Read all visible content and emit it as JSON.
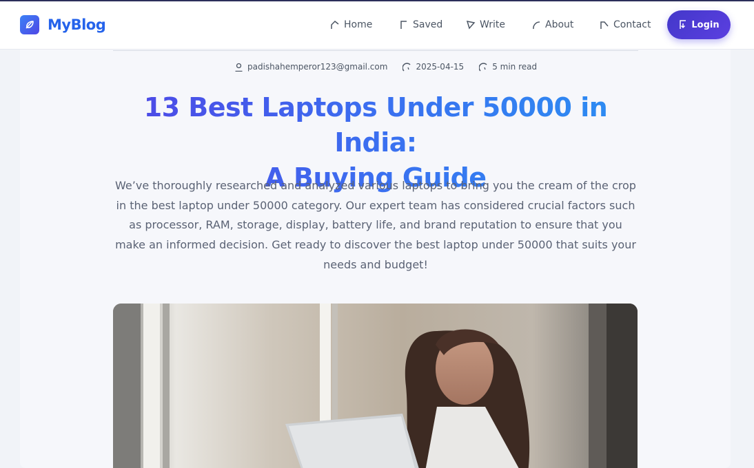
{
  "brand": {
    "name": "MyBlog",
    "logo_icon": "feather-icon"
  },
  "nav": [
    {
      "label": "Home",
      "icon": "home-icon"
    },
    {
      "label": "Saved",
      "icon": "bookmark-icon"
    },
    {
      "label": "Write",
      "icon": "pen-icon"
    },
    {
      "label": "About",
      "icon": "info-icon"
    },
    {
      "label": "Contact",
      "icon": "mail-icon"
    }
  ],
  "login": {
    "label": "Login",
    "icon": "login-icon"
  },
  "meta": {
    "author": "padishahemperor123@gmail.com",
    "date": "2025-04-15",
    "read_time": "5 min read"
  },
  "article": {
    "title_line1": "13 Best Laptops Under 50000 in India:",
    "title_line2": "A Buying Guide",
    "intro": "We’ve thoroughly researched and analyzed various laptops to bring you the cream of the crop in the best laptop under 50000 category. Our expert team has considered crucial factors such as processor, RAM, storage, display, battery life, and brand reputation to ensure that you make an informed decision. Get ready to discover the best laptop under 50000 that suits your needs and budget!"
  },
  "colors": {
    "brand": "#2563eb",
    "accent": "#4f46e5",
    "title_gradient_start": "#4f46e5",
    "title_gradient_end": "#2b8ff2"
  }
}
